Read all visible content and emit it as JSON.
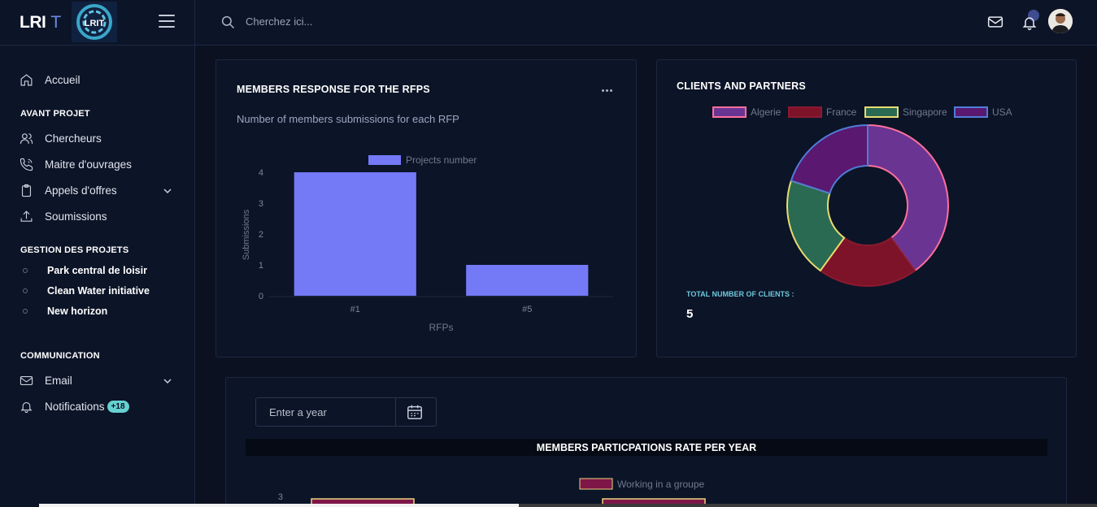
{
  "brand": {
    "text": "LRI",
    "t": "T",
    "logo_text": "LRIT"
  },
  "topbar": {
    "search_placeholder": "Cherchez ici..."
  },
  "sidebar": {
    "home": "Accueil",
    "cat_avant": "AVANT PROJET",
    "chercheurs": "Chercheurs",
    "maitre": "Maitre d'ouvrages",
    "appels": "Appels d'offres",
    "soumissions": "Soumissions",
    "cat_gestion": "GESTION DES PROJETS",
    "projects": [
      "Park central de loisir",
      "Clean Water initiative",
      "New horizon"
    ],
    "cat_comm": "COMMUNICATION",
    "email": "Email",
    "notifications": "Notifications",
    "notif_badge": "+18"
  },
  "card1": {
    "title": "MEMBERS RESPONSE FOR THE RFPS",
    "subtitle": "Number of members submissions for each RFP"
  },
  "card2": {
    "title": "CLIENTS AND PARTNERS",
    "total_label": "TOTAL NUMBER OF CLIENTS :",
    "total_value": "5"
  },
  "card3": {
    "year_placeholder": "Enter a year",
    "chart_title": "MEMBERS PARTICPATIONS RATE PER YEAR"
  },
  "chart_data": [
    {
      "type": "bar",
      "categories": [
        "#1",
        "#5"
      ],
      "series": [
        {
          "name": "Projects number",
          "values": [
            4,
            1
          ]
        }
      ],
      "xlabel": "RFPs",
      "ylabel": "Submissions",
      "ylim": [
        0,
        4
      ],
      "yticks": [
        "0",
        "1",
        "2",
        "3",
        "4"
      ],
      "color": "#7479f5",
      "legend": "top"
    },
    {
      "type": "pie",
      "donut": true,
      "labels": [
        "Algerie",
        "France",
        "Singapore",
        "USA"
      ],
      "values": [
        2,
        1,
        1,
        1
      ],
      "fills": [
        "#6a3592",
        "#7d1328",
        "#2a6a53",
        "#5a1870"
      ],
      "borders": [
        "#ff6f9e",
        "#8a1a30",
        "#e8dc6e",
        "#4f7dd6"
      ],
      "legend": "top"
    },
    {
      "type": "bar",
      "categories": [],
      "series": [
        {
          "name": "Working in a groupe",
          "values": [
            3,
            3
          ]
        }
      ],
      "yticks": [
        "3"
      ],
      "color": "#7e1748",
      "border": "#e8d37b",
      "legend": "top"
    }
  ]
}
